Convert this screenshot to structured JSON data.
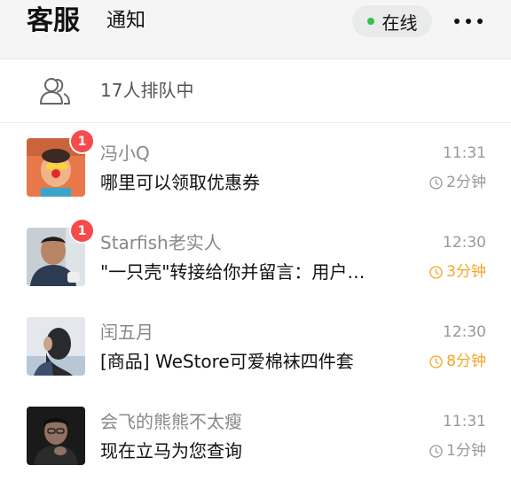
{
  "header": {
    "tabs": [
      {
        "label": "客服",
        "active": true
      },
      {
        "label": "通知",
        "active": false
      }
    ],
    "status": {
      "label": "在线",
      "dot_color": "#2fc155"
    },
    "more_icon": "more-dots-icon"
  },
  "queue": {
    "icon": "users-icon",
    "text": "17人排队中"
  },
  "conversations": [
    {
      "name": "冯小Q",
      "time": "11:31",
      "message": "哪里可以领取优惠券",
      "wait": "2分钟",
      "wait_color": "#999999",
      "badge": "1"
    },
    {
      "name": "Starfish老实人",
      "time": "12:30",
      "message": "\"一只壳\"转接给你并留言：用户…",
      "wait": "3分钟",
      "wait_color": "#f5a623",
      "badge": "1"
    },
    {
      "name": "闰五月",
      "time": "12:30",
      "message": "[商品] WeStore可爱棉袜四件套",
      "wait": "8分钟",
      "wait_color": "#f5a623",
      "badge": null
    },
    {
      "name": "会飞的熊熊不太瘦",
      "time": "11:31",
      "message": "现在立马为您查询",
      "wait": "1分钟",
      "wait_color": "#999999",
      "badge": null
    }
  ]
}
